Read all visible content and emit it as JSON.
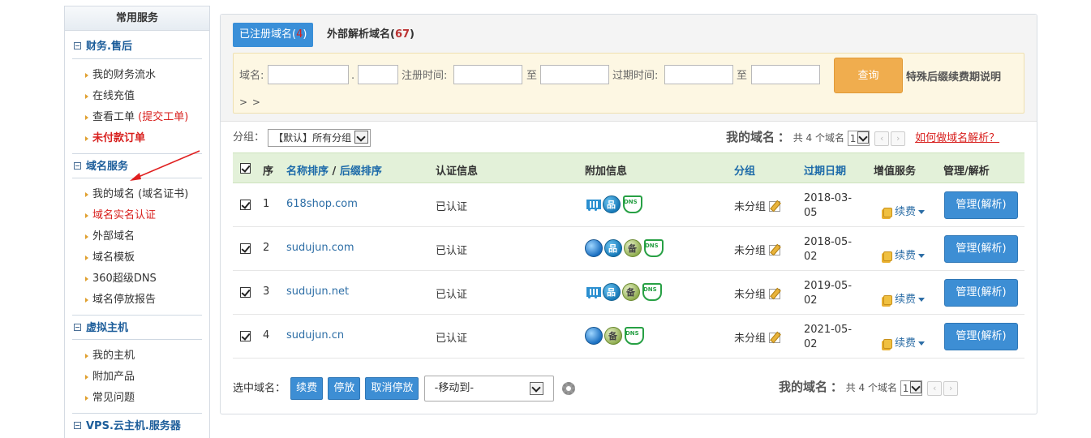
{
  "sidebar": {
    "header": "常用服务",
    "groups": [
      {
        "title": "财务.售后",
        "items": [
          {
            "label": "我的财务流水"
          },
          {
            "label": "在线充值"
          },
          {
            "label": "查看工单",
            "extra": "(提交工单)"
          },
          {
            "label": "未付款订单"
          }
        ]
      },
      {
        "title": "域名服务",
        "items": [
          {
            "label": "我的域名 (域名证书)"
          },
          {
            "label": "域名实名认证"
          },
          {
            "label": "外部域名"
          },
          {
            "label": "域名模板"
          },
          {
            "label": "360超级DNS"
          },
          {
            "label": "域名停放报告"
          }
        ]
      },
      {
        "title": "虚拟主机",
        "items": [
          {
            "label": "我的主机"
          },
          {
            "label": "附加产品"
          },
          {
            "label": "常见问题"
          }
        ]
      },
      {
        "title": "VPS.云主机.服务器",
        "items": []
      }
    ]
  },
  "tabs": {
    "registered": {
      "label": "已注册域名(",
      "count": "4",
      "close": ")"
    },
    "external": {
      "label": "外部解析域名(",
      "count": "67",
      "close": ")"
    }
  },
  "search": {
    "domain_label": "域名:",
    "dot": ".",
    "reg_time_label": "注册时间:",
    "to": "至",
    "exp_time_label": "过期时间:",
    "query_button": "查询",
    "special_link": "特殊后缀续费期说明",
    "more": "> >"
  },
  "filter": {
    "group_label": "分组：",
    "group_value": "【默认】所有分组"
  },
  "summary": {
    "title": "我的域名",
    "colon": "：",
    "count_text": "共 4 个域名",
    "page": "1",
    "prev": "‹",
    "next": "›",
    "howto": "如何做域名解析？"
  },
  "table": {
    "headers": {
      "seq": "序",
      "name_sort": "名称排序",
      "slash": " / ",
      "suffix_sort": "后缀排序",
      "auth": "认证信息",
      "extra": "附加信息",
      "group": "分组",
      "expiry": "过期日期",
      "value_added": "增值服务",
      "manage": "管理/解析"
    },
    "rows": [
      {
        "seq": "1",
        "domain": "618shop.com",
        "auth": "已认证",
        "icons": [
          "cart-icon",
          "network-icon",
          "dns-icon"
        ],
        "group": "未分组",
        "expiry_a": "2018-03-",
        "expiry_b": "05",
        "renew": "续费",
        "manage": "管理(解析)"
      },
      {
        "seq": "2",
        "domain": "sudujun.com",
        "auth": "已认证",
        "icons": [
          "globe-icon",
          "network-icon",
          "beian-icon",
          "dns-icon"
        ],
        "group": "未分组",
        "expiry_a": "2018-05-",
        "expiry_b": "02",
        "renew": "续费",
        "manage": "管理(解析)"
      },
      {
        "seq": "3",
        "domain": "sudujun.net",
        "auth": "已认证",
        "icons": [
          "cart-icon",
          "network-icon",
          "beian-icon",
          "dns-icon"
        ],
        "group": "未分组",
        "expiry_a": "2019-05-",
        "expiry_b": "02",
        "renew": "续费",
        "manage": "管理(解析)"
      },
      {
        "seq": "4",
        "domain": "sudujun.cn",
        "auth": "已认证",
        "icons": [
          "globe-icon",
          "beian-icon",
          "dns-icon"
        ],
        "group": "未分组",
        "expiry_a": "2021-05-",
        "expiry_b": "02",
        "renew": "续费",
        "manage": "管理(解析)"
      }
    ]
  },
  "bottom": {
    "selected_label": "选中域名：",
    "renew": "续费",
    "park": "停放",
    "unpark": "取消停放",
    "move_to": "-移动到-"
  },
  "colors": {
    "accent_blue": "#3a8fd8",
    "query_orange": "#f0ad4e",
    "alert_red": "#d8201e",
    "header_green": "#e3f1d9"
  }
}
